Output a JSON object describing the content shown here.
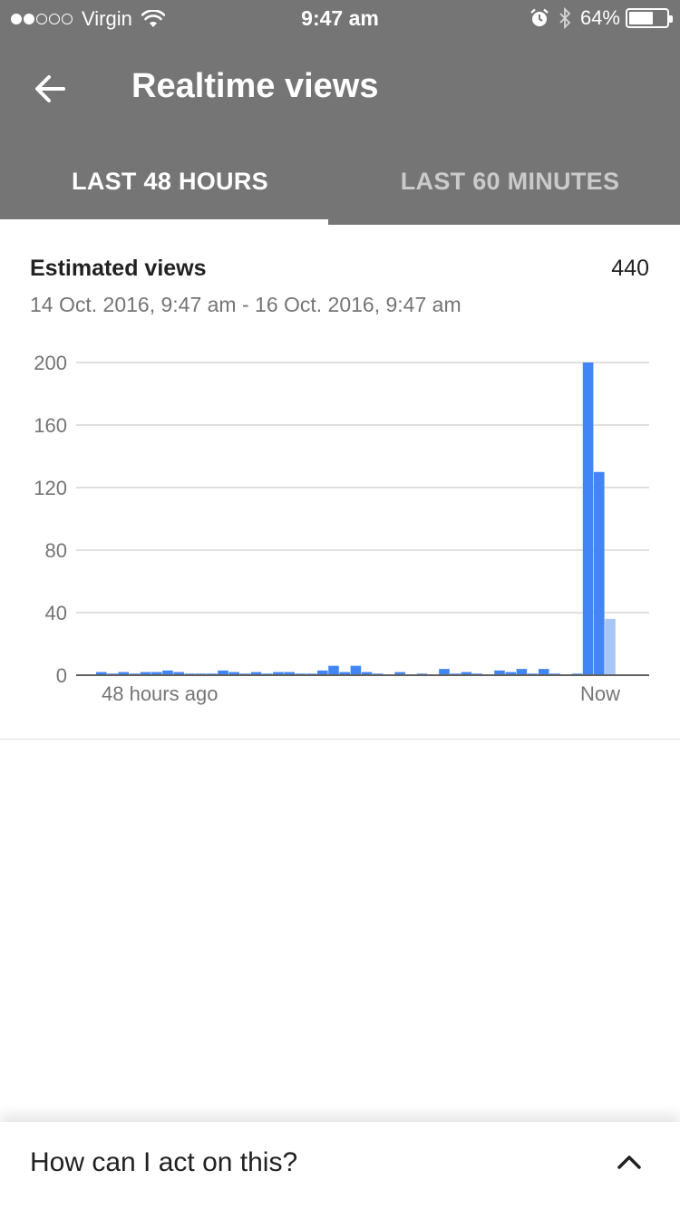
{
  "status_bar": {
    "carrier": "Virgin",
    "time": "9:47 am",
    "battery": "64%",
    "signal_strength": 2,
    "signal_max": 5,
    "battery_level": 0.64
  },
  "toolbar": {
    "title": "Realtime views",
    "back_icon": "arrow-back-icon"
  },
  "tabs": [
    {
      "label": "LAST 48 HOURS",
      "active": true
    },
    {
      "label": "LAST 60 MINUTES",
      "active": false
    }
  ],
  "card": {
    "metric_title": "Estimated views",
    "metric_value": "440",
    "date_range": "14 Oct. 2016, 9:47 am - 16 Oct. 2016, 9:47 am"
  },
  "chart_data": {
    "type": "bar",
    "ylim": [
      0,
      200
    ],
    "y_ticks": [
      "200",
      "160",
      "120",
      "80",
      "40",
      "0"
    ],
    "x_start_label": "48 hours ago",
    "x_end_label": "Now",
    "grid": true,
    "colors": {
      "bar": "#4285f4",
      "current_bar": "#a9c6f9",
      "grid": "#e0e0e0",
      "axis": "#616161"
    },
    "values": [
      2,
      1,
      2,
      1,
      2,
      2,
      3,
      2,
      1,
      1,
      1,
      3,
      2,
      1,
      2,
      1,
      2,
      2,
      1,
      1,
      3,
      6,
      2,
      6,
      2,
      1,
      0,
      2,
      0,
      1,
      0,
      4,
      1,
      2,
      1,
      0,
      3,
      2,
      4,
      1,
      4,
      1,
      0,
      1,
      200,
      130,
      36
    ],
    "partial_last": true
  },
  "bottom_sheet": {
    "label": "How can I act on this?",
    "icon": "chevron-up-icon"
  }
}
